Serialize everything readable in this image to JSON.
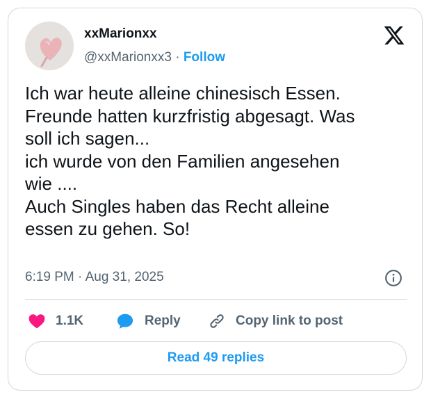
{
  "tweet": {
    "author": {
      "display_name": "xxMarionxx",
      "handle": "@xxMarionxx3",
      "separator": " · ",
      "follow_label": "Follow"
    },
    "text_lines": [
      "Ich war heute alleine chinesisch Essen.",
      "Freunde hatten kurzfristig abgesagt. Was",
      "soll ich sagen...",
      "ich wurde von den Familien angesehen",
      "wie ....",
      "Auch Singles haben das Recht alleine",
      "essen zu gehen. So!"
    ],
    "timestamp": "6:19 PM · Aug 31, 2025",
    "actions": {
      "like_count": "1.1K",
      "reply_label": "Reply",
      "copy_link_label": "Copy link to post"
    },
    "read_replies_label": "Read 49 replies"
  },
  "colors": {
    "accent": "#1d9bf0",
    "like": "#f91880",
    "text": "#0f1419",
    "muted": "#536471",
    "border": "#cfd9de"
  },
  "icons": [
    "x-logo-icon",
    "info-icon",
    "heart-icon",
    "reply-bubble-icon",
    "link-icon"
  ]
}
